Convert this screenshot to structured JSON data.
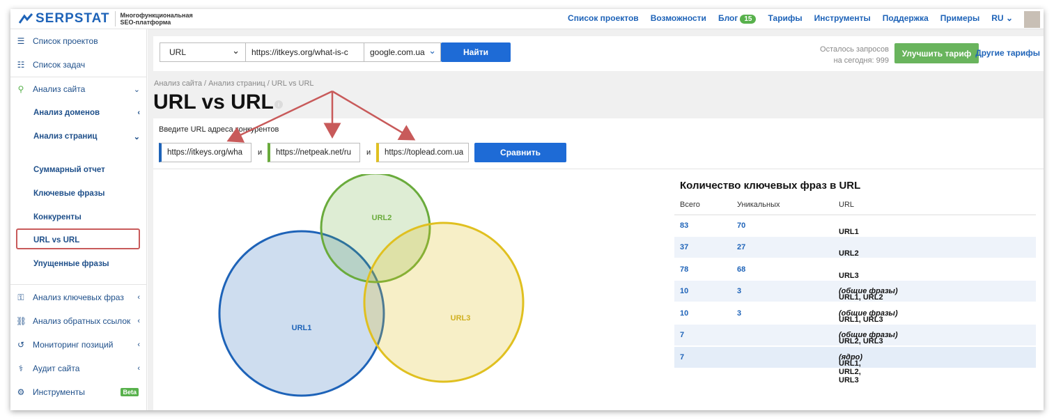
{
  "header": {
    "brand": "SERPSTAT",
    "subtitle_line1": "Многофункциональная",
    "subtitle_line2": "SEO-платформа",
    "nav": [
      "Список проектов",
      "Возможности",
      "Блог",
      "Тарифы",
      "Инструменты",
      "Поддержка",
      "Примеры",
      "RU"
    ],
    "blog_badge": "15"
  },
  "sidebar": {
    "items": [
      {
        "label": "Список проектов",
        "icon": "menu-icon"
      },
      {
        "label": "Список задач",
        "icon": "list-icon"
      },
      {
        "label": "Анализ сайта",
        "icon": "site-analysis-icon"
      },
      {
        "label": "Анализ доменов"
      },
      {
        "label": "Анализ страниц"
      },
      {
        "label": "Суммарный отчет"
      },
      {
        "label": "Ключевые фразы"
      },
      {
        "label": "Конкуренты"
      },
      {
        "label": "URL vs URL"
      },
      {
        "label": "Упущенные фразы"
      },
      {
        "label": "Анализ ключевых фраз",
        "icon": "key-icon"
      },
      {
        "label": "Анализ обратных ссылок",
        "icon": "link-icon"
      },
      {
        "label": "Мониторинг позиций",
        "icon": "history-icon"
      },
      {
        "label": "Аудит сайта",
        "icon": "audit-icon"
      },
      {
        "label": "Инструменты",
        "icon": "gear-icon"
      }
    ],
    "beta": "Beta"
  },
  "search": {
    "type": "URL",
    "url": "https://itkeys.org/what-is-c",
    "engine": "google.com.ua",
    "find": "Найти",
    "remaining_line1": "Осталось запросов",
    "remaining_line2": "на сегодня: 999",
    "upgrade": "Улучшить тариф",
    "other_plans": "Другие тарифы"
  },
  "page": {
    "breadcrumb": "Анализ сайта / Анализ страниц / URL vs URL",
    "title": "URL vs URL",
    "prompt": "Введите URL адреса конкурентов",
    "url1": "https://itkeys.org/wha",
    "url2": "https://netpeak.net/ru",
    "url3": "https://toplead.com.ua",
    "and": "и",
    "compare": "Сравнить"
  },
  "venn": {
    "labels": [
      "URL1",
      "URL2",
      "URL3"
    ],
    "colors": [
      "#1e63b8",
      "#6aab3c",
      "#e0c020"
    ]
  },
  "table": {
    "title": "Количество ключевых фраз в URL",
    "headers": [
      "Всего",
      "Уникальных",
      "URL"
    ],
    "rows": [
      {
        "total": "83",
        "unique": "70",
        "url": "URL1",
        "note": ""
      },
      {
        "total": "37",
        "unique": "27",
        "url": "URL2",
        "note": ""
      },
      {
        "total": "78",
        "unique": "68",
        "url": "URL3",
        "note": ""
      },
      {
        "total": "10",
        "unique": "3",
        "url": "URL1, URL2",
        "note": "(общие фразы)"
      },
      {
        "total": "10",
        "unique": "3",
        "url": "URL1, URL3",
        "note": "(общие фразы)"
      },
      {
        "total": "7",
        "unique": "",
        "url": "URL2, URL3",
        "note": "(общие фразы)"
      },
      {
        "total": "7",
        "unique": "",
        "url": "URL1, URL2, URL3",
        "note": "(ядро)"
      }
    ]
  }
}
